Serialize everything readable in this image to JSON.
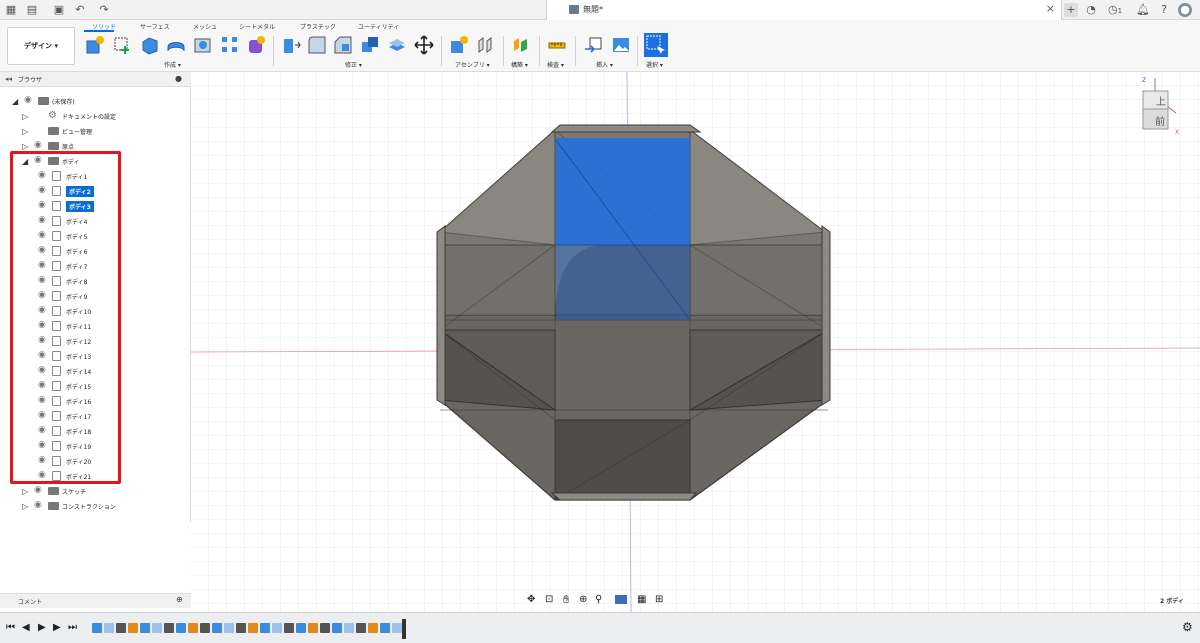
{
  "titlebar": {
    "doc_title": "無題*",
    "user_count": "1",
    "icons": [
      "apps-grid-icon",
      "file-menu-icon",
      "save-icon",
      "undo-icon",
      "redo-icon",
      "close-icon",
      "new-tab-icon",
      "jobs-icon",
      "clock-icon",
      "notifications-icon",
      "help-icon",
      "user-avatar-icon"
    ]
  },
  "toolbar": {
    "workspace_label": "デザイン ▾",
    "tabs": [
      "ソリッド",
      "サーフェス",
      "メッシュ",
      "シートメタル",
      "プラスチック",
      "ユーティリティ"
    ],
    "active_tab": "ソリッド",
    "groups": [
      {
        "label": "作成 ▾"
      },
      {
        "label": "修正 ▾"
      },
      {
        "label": "アセンブリ ▾"
      },
      {
        "label": "構築 ▾"
      },
      {
        "label": "検査 ▾"
      },
      {
        "label": "挿入 ▾"
      },
      {
        "label": "選択 ▾"
      }
    ],
    "accent": "#0a6ed1"
  },
  "browser": {
    "title": "ブラウザ",
    "root_label": "(未保存)",
    "items": [
      {
        "label": "ドキュメントの設定"
      },
      {
        "label": "ビュー管理"
      },
      {
        "label": "原点"
      },
      {
        "label": "ボディ"
      }
    ],
    "bodies": [
      {
        "label": "ボディ1",
        "selected": false
      },
      {
        "label": "ボディ2",
        "selected": true
      },
      {
        "label": "ボディ3",
        "selected": true
      },
      {
        "label": "ボディ4",
        "selected": false
      },
      {
        "label": "ボディ5",
        "selected": false
      },
      {
        "label": "ボディ6",
        "selected": false
      },
      {
        "label": "ボディ7",
        "selected": false
      },
      {
        "label": "ボディ8",
        "selected": false
      },
      {
        "label": "ボディ9",
        "selected": false
      },
      {
        "label": "ボディ10",
        "selected": false
      },
      {
        "label": "ボディ11",
        "selected": false
      },
      {
        "label": "ボディ12",
        "selected": false
      },
      {
        "label": "ボディ13",
        "selected": false
      },
      {
        "label": "ボディ14",
        "selected": false
      },
      {
        "label": "ボディ15",
        "selected": false
      },
      {
        "label": "ボディ16",
        "selected": false
      },
      {
        "label": "ボディ17",
        "selected": false
      },
      {
        "label": "ボディ18",
        "selected": false
      },
      {
        "label": "ボディ19",
        "selected": false
      },
      {
        "label": "ボディ20",
        "selected": false
      },
      {
        "label": "ボディ21",
        "selected": false
      }
    ],
    "after_items": [
      {
        "label": "スケッチ"
      },
      {
        "label": "コンストラクション"
      }
    ],
    "highlight_color": "#e8131b"
  },
  "viewcube": {
    "top": "上",
    "front": "前",
    "axis_z": "Z",
    "axis_y": "Y",
    "axis_x": "X"
  },
  "status": {
    "selection_count": "2 ボディ"
  },
  "comments": {
    "label": "コメント"
  },
  "colors": {
    "selection": "#1f6fe0",
    "body": "#5e5b57"
  }
}
